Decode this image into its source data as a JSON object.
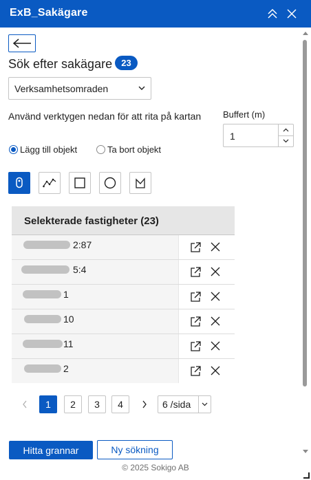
{
  "window": {
    "title": "ExB_Sakägare",
    "collapse_icon": "double-chevron-up-icon",
    "close_icon": "close-icon"
  },
  "panel": {
    "back_icon": "arrow-left-icon",
    "heading": "Sök efter sakägare",
    "result_count": "23",
    "layer_select": {
      "value": "Verksamhetsomraden"
    },
    "instructions": "Använd verktygen nedan för att rita på kartan",
    "buffer": {
      "label": "Buffert (m)",
      "value": "1"
    },
    "mode": {
      "add_label": "Lägg till objekt",
      "remove_label": "Ta bort objekt",
      "selected": "add"
    },
    "tools": [
      {
        "name": "point-tool",
        "icon": "pin-icon",
        "active": true
      },
      {
        "name": "polyline-tool",
        "icon": "polyline-icon",
        "active": false
      },
      {
        "name": "rectangle-tool",
        "icon": "rectangle-icon",
        "active": false
      },
      {
        "name": "circle-tool",
        "icon": "circle-icon",
        "active": false
      },
      {
        "name": "polygon-tool",
        "icon": "polygon-icon",
        "active": false
      }
    ]
  },
  "table": {
    "header": "Selekterade fastigheter (23)",
    "rows": [
      {
        "visible_suffix": "2:87"
      },
      {
        "visible_suffix": "5:4"
      },
      {
        "visible_suffix": "1"
      },
      {
        "visible_suffix": "10"
      },
      {
        "visible_suffix": "11"
      },
      {
        "visible_suffix": "2"
      }
    ],
    "row_actions": {
      "open_icon": "open-external-icon",
      "delete_icon": "close-icon"
    }
  },
  "pagination": {
    "pages": [
      "1",
      "2",
      "3",
      "4"
    ],
    "current": "1",
    "page_size": "6 /sida"
  },
  "actions": {
    "find_neighbors": "Hitta grannar",
    "new_search": "Ny sökning"
  },
  "footer": "© 2025 Sokigo AB",
  "colors": {
    "primary": "#0a5ac2",
    "header_bg": "#e6e6e6",
    "row_bg": "#f5f5f5"
  }
}
